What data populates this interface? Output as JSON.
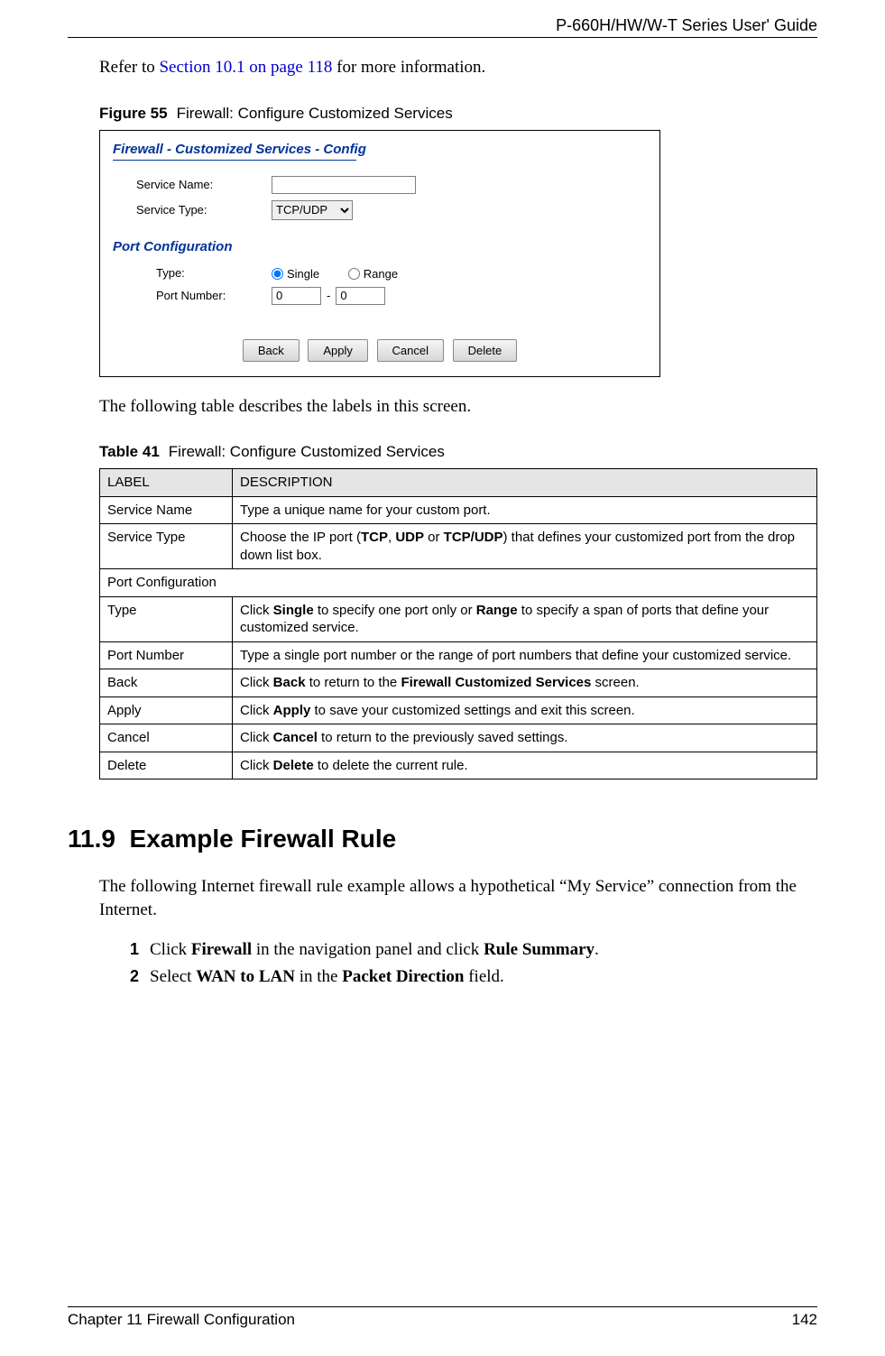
{
  "header": {
    "guide_title": "P-660H/HW/W-T Series User' Guide"
  },
  "intro": {
    "refer_pre": "Refer to ",
    "refer_link": "Section 10.1 on page 118",
    "refer_post": " for more information."
  },
  "figure": {
    "label": "Figure 55",
    "title": "Firewall: Configure Customized Services"
  },
  "screenshot": {
    "panel_title": "Firewall - Customized Services - Config",
    "service_name_label": "Service Name:",
    "service_name_value": "",
    "service_type_label": "Service Type:",
    "service_type_value": "TCP/UDP",
    "port_config_heading": "Port Configuration",
    "type_label": "Type:",
    "radio_single_label": "Single",
    "radio_range_label": "Range",
    "port_number_label": "Port Number:",
    "port_from_value": "0",
    "port_dash": "-",
    "port_to_value": "0",
    "buttons": {
      "back": "Back",
      "apply": "Apply",
      "cancel": "Cancel",
      "delete": "Delete"
    }
  },
  "table_intro": "The following table describes the labels in this screen.",
  "table_caption": {
    "label": "Table 41",
    "title": "Firewall: Configure Customized Services"
  },
  "table_headers": {
    "label": "LABEL",
    "description": "DESCRIPTION"
  },
  "table_rows": [
    {
      "label": "Service Name",
      "desc_pre": "Type a unique name for your custom port.",
      "bold": []
    },
    {
      "label": "Service Type",
      "desc": {
        "p1": "Choose the IP port (",
        "b1": "TCP",
        "c1": ", ",
        "b2": "UDP",
        "c2": " or ",
        "b3": "TCP/UDP",
        "p2": ") that defines your customized port from the drop down list box."
      }
    },
    {
      "span": "Port Configuration"
    },
    {
      "label": "Type",
      "desc": {
        "p1": "Click ",
        "b1": "Single",
        "c1": " to specify one port only or ",
        "b2": "Range",
        "p2": " to specify a span of ports that define your customized service."
      }
    },
    {
      "label": "Port Number",
      "desc_pre": "Type a single port number or the range of port numbers that define your customized service."
    },
    {
      "label": "Back",
      "desc": {
        "p1": "Click ",
        "b1": "Back",
        "c1": " to return to the ",
        "b2": "Firewall Customized Services",
        "p2": " screen."
      }
    },
    {
      "label": "Apply",
      "desc": {
        "p1": "Click ",
        "b1": "Apply",
        "p2": " to save your customized settings and exit this screen."
      }
    },
    {
      "label": "Cancel",
      "desc": {
        "p1": "Click ",
        "b1": "Cancel",
        "p2": " to return to the previously saved settings."
      }
    },
    {
      "label": "Delete",
      "desc": {
        "p1": "Click ",
        "b1": "Delete",
        "p2": " to delete the current rule."
      }
    }
  ],
  "section": {
    "number": "11.9",
    "title": "Example Firewall Rule"
  },
  "section_body": "The following Internet firewall rule example allows a hypothetical “My Service” connection from the Internet.",
  "steps": [
    {
      "n": "1",
      "p1": "Click ",
      "b1": "Firewall",
      "c1": " in the navigation panel and click ",
      "b2": "Rule Summary",
      "p2": "."
    },
    {
      "n": "2",
      "p1": "Select ",
      "b1": "WAN to LAN",
      "c1": " in the ",
      "b2": "Packet Direction",
      "p2": " field."
    }
  ],
  "footer": {
    "chapter": "Chapter 11 Firewall Configuration",
    "page": "142"
  }
}
